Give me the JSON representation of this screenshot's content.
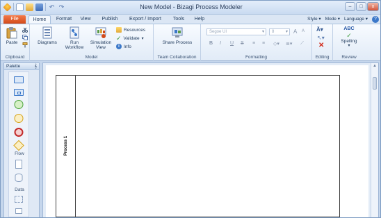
{
  "window": {
    "title": "New Model - Bizagi Process Modeler",
    "controls": {
      "minimize": "–",
      "maximize": "□",
      "close": "x"
    }
  },
  "quick_access": {
    "undo": "↶",
    "redo": "↷"
  },
  "tabs": [
    {
      "label": "File"
    },
    {
      "label": "Home"
    },
    {
      "label": "Format"
    },
    {
      "label": "View"
    },
    {
      "label": "Publish"
    },
    {
      "label": "Export / Import"
    },
    {
      "label": "Tools"
    },
    {
      "label": "Help"
    }
  ],
  "right_menus": {
    "style": "Style",
    "mode": "Mode",
    "language": "Language",
    "help_icon": "?"
  },
  "ribbon": {
    "clipboard": {
      "label": "Clipboard",
      "paste": "Paste"
    },
    "model": {
      "label": "Model",
      "diagrams": "Diagrams",
      "run_workflow": "Run\nWorkflow",
      "simulation_view": "Simulation\nView",
      "resources": "Resources",
      "validate": "Validate",
      "info": "Info"
    },
    "team": {
      "label": "Team Collaboration",
      "share_process": "Share Process"
    },
    "formatting": {
      "label": "Formatting",
      "font": "Segoe UI",
      "size": "8",
      "grow": "A",
      "shrink": "A",
      "bold": "B",
      "italic": "I",
      "underline": "U",
      "strike": "S"
    },
    "editing": {
      "label": "Editing"
    },
    "review": {
      "label": "Review",
      "spelling": "Spelling",
      "abc": "ABC"
    }
  },
  "palette": {
    "title": "Palette",
    "pin": "ᵖ",
    "categories": {
      "flow": "Flow",
      "data": "Data"
    }
  },
  "diagram": {
    "pool_title": "Process 1"
  },
  "colors": {
    "file_tab": "#e05a26",
    "ribbon_bg": "#e1ebf7",
    "accent": "#3b78c9"
  }
}
